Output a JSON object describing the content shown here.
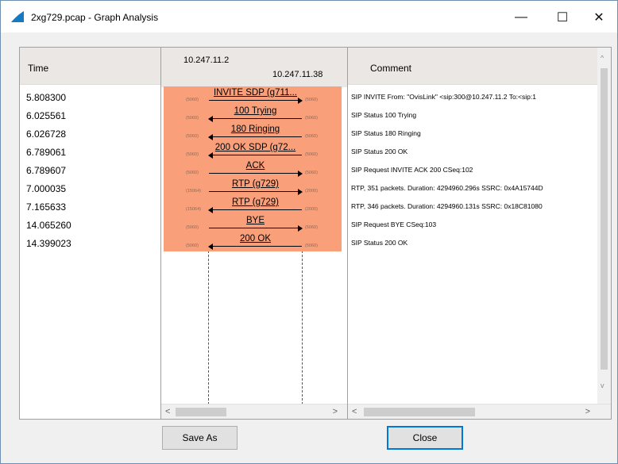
{
  "window": {
    "title": "2xg729.pcap - Graph Analysis",
    "controls": {
      "minimize": "—",
      "maximize": "☐",
      "close": "✕"
    }
  },
  "time_column": {
    "header": "Time",
    "rows": [
      "5.808300",
      "6.025561",
      "6.026728",
      "6.789061",
      "6.789607",
      "7.000035",
      "7.165633",
      "14.065260",
      "14.399023"
    ]
  },
  "graph": {
    "hosts": [
      "10.247.11.2",
      "10.247.11.38"
    ],
    "messages": [
      {
        "label": "INVITE SDP (g711...",
        "direction": "right",
        "src_port": "(5060)",
        "dst_port": "(5060)"
      },
      {
        "label": "100 Trying",
        "direction": "left",
        "src_port": "(5060)",
        "dst_port": "(5060)"
      },
      {
        "label": "180 Ringing",
        "direction": "left",
        "src_port": "(5060)",
        "dst_port": "(5060)"
      },
      {
        "label": "200 OK SDP (g72...",
        "direction": "left",
        "src_port": "(5060)",
        "dst_port": "(5060)"
      },
      {
        "label": "ACK",
        "direction": "right",
        "src_port": "(5060)",
        "dst_port": "(5060)"
      },
      {
        "label": "RTP (g729)",
        "direction": "right",
        "src_port": "(15064)",
        "dst_port": "(2000)"
      },
      {
        "label": "RTP (g729)",
        "direction": "left",
        "src_port": "(15064)",
        "dst_port": "(2000)"
      },
      {
        "label": "BYE",
        "direction": "right",
        "src_port": "(5060)",
        "dst_port": "(5060)"
      },
      {
        "label": "200 OK",
        "direction": "left",
        "src_port": "(5060)",
        "dst_port": "(5060)"
      }
    ],
    "highlight_color": "#f9a07b"
  },
  "comment_column": {
    "header": "Comment",
    "rows": [
      "SIP INVITE From: \"OvisLink\" <sip:300@10.247.11.2 To:<sip:1",
      "SIP Status 100 Trying",
      "SIP Status 180 Ringing",
      "SIP Status 200 OK",
      "SIP Request INVITE ACK 200 CSeq:102",
      "RTP, 351 packets. Duration: 4294960.296s SSRC: 0x4A15744D",
      "RTP, 346 packets. Duration: 4294960.131s SSRC: 0x18C81080",
      "SIP Request BYE CSeq:103",
      "SIP Status 200 OK"
    ]
  },
  "buttons": {
    "save_as": "Save As",
    "close": "Close"
  }
}
